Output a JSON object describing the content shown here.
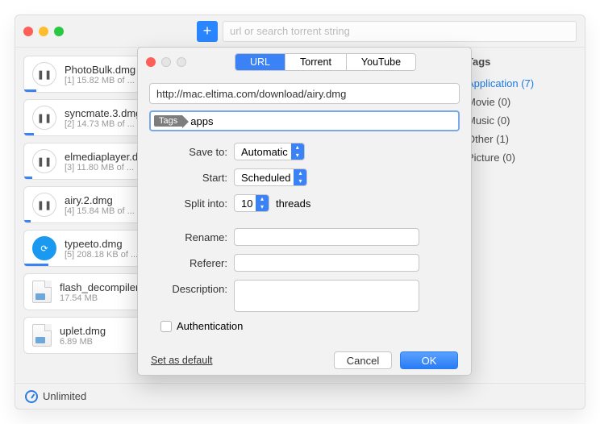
{
  "toolbar": {
    "search_placeholder": "url or search torrent string"
  },
  "sidebar": {
    "header": "Tags",
    "items": [
      {
        "label": "Application (7)",
        "selected": true
      },
      {
        "label": "Movie (0)"
      },
      {
        "label": "Music (0)"
      },
      {
        "label": "Other (1)"
      },
      {
        "label": "Picture (0)"
      }
    ]
  },
  "downloads": [
    {
      "name": "PhotoBulk.dmg",
      "sub": "[1] 15.82 MB of ...",
      "icon": "pause",
      "progress": 15
    },
    {
      "name": "syncmate.3.dmg",
      "sub": "[2] 14.73 MB of ...",
      "icon": "pause",
      "progress": 12
    },
    {
      "name": "elmediaplayer.dmg",
      "sub": "[3] 11.80 MB of ...",
      "icon": "pause",
      "progress": 10
    },
    {
      "name": "airy.2.dmg",
      "sub": "[4] 15.84 MB of ...",
      "icon": "pause",
      "progress": 8
    },
    {
      "name": "typeeto.dmg",
      "sub": "[5] 208.18 KB of ...",
      "icon": "refresh",
      "progress": 30
    },
    {
      "name": "flash_decompiler.dmg",
      "sub": "17.54 MB",
      "icon": "file"
    },
    {
      "name": "uplet.dmg",
      "sub": "6.89 MB",
      "icon": "file"
    }
  ],
  "statusbar": {
    "label": "Unlimited"
  },
  "dialog": {
    "tabs": [
      "URL",
      "Torrent",
      "YouTube"
    ],
    "url_value": "http://mac.eltima.com/download/airy.dmg",
    "tags_chip": "Tags",
    "tags_value": "apps",
    "labels": {
      "save_to": "Save to:",
      "start": "Start:",
      "split": "Split into:",
      "threads": "threads",
      "rename": "Rename:",
      "referer": "Referer:",
      "description": "Description:",
      "auth": "Authentication",
      "set_default": "Set as default"
    },
    "save_to_value": "Automatic",
    "start_value": "Scheduled",
    "split_value": "10",
    "buttons": {
      "cancel": "Cancel",
      "ok": "OK"
    }
  }
}
